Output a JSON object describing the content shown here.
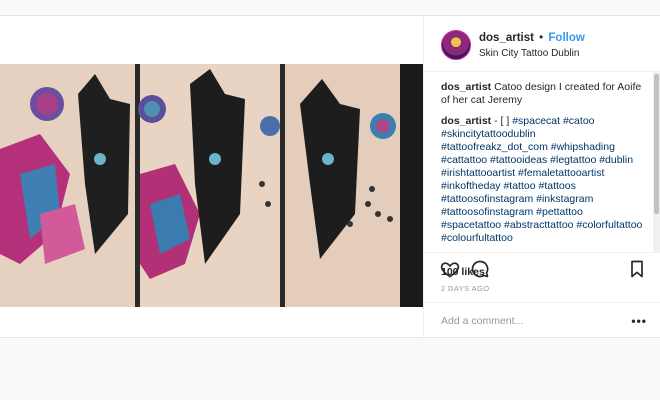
{
  "post": {
    "author": {
      "username": "dos_artist",
      "separator": "•",
      "follow_label": "Follow",
      "location": "Skin City Tattoo Dublin"
    },
    "comments": [
      {
        "username": "dos_artist",
        "text": " Catoo design I created for Aoife of her cat Jeremy"
      },
      {
        "username": "dos_artist",
        "text": " - [ ] ",
        "tags": "#spacecat #catoo #skincitytattoodublin #tattoofreakz_dot_com #whipshading #cattattoo #tattooideas #legtattoo #dublin #irishtattooartist #femaletattooartist #inkoftheday #tattoo #tattoos #tattoosofinstagram #inkstagram #tattoosofinstagram #pettattoo #spacetattoo #abstracttattoo #colorfultattoo #colourfultattoo"
      }
    ],
    "likes": "100 likes",
    "date": "2 DAYS AGO",
    "comment_placeholder": "Add a comment...",
    "more_label": "•••"
  },
  "icons": {
    "like": "heart-icon",
    "comment": "comment-bubble-icon",
    "save": "bookmark-icon",
    "more": "more-options-icon"
  },
  "colors": {
    "accent": "#3897f0",
    "hashtag": "#003569"
  }
}
